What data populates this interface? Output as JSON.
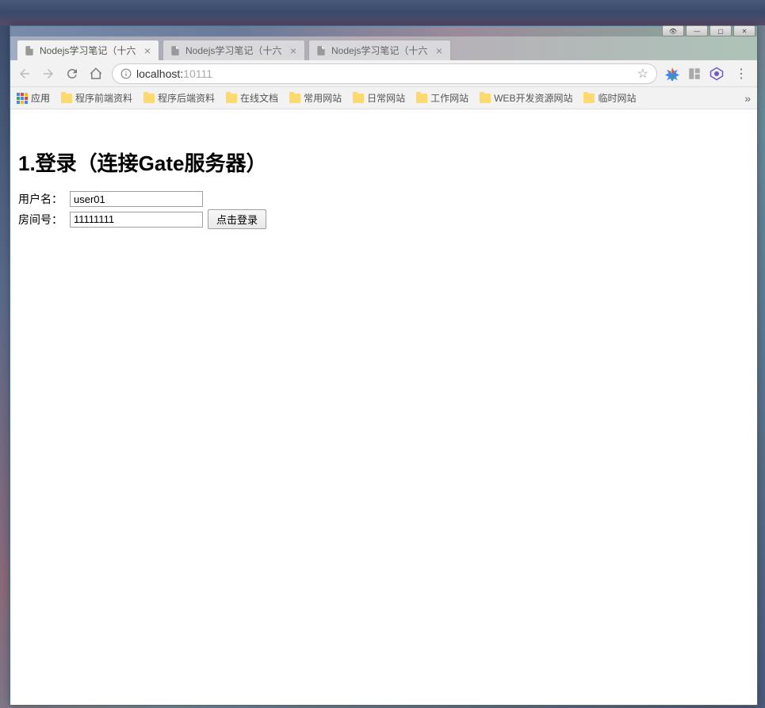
{
  "window": {
    "tabs": [
      {
        "title": "Nodejs学习笔记（十六",
        "active": true
      },
      {
        "title": "Nodejs学习笔记（十六",
        "active": false
      },
      {
        "title": "Nodejs学习笔记（十六",
        "active": false
      }
    ]
  },
  "toolbar": {
    "url_host": "localhost:",
    "url_port": "10111"
  },
  "bookmarks": {
    "apps_label": "应用",
    "items": [
      "程序前端资料",
      "程序后端资料",
      "在线文档",
      "常用网站",
      "日常网站",
      "工作网站",
      "WEB开发资源网站",
      "临时网站"
    ]
  },
  "page": {
    "heading": "1.登录（连接Gate服务器）",
    "username_label": "用户名：",
    "username_value": "user01",
    "room_label": "房间号：",
    "room_value": "11111111",
    "login_button": "点击登录"
  }
}
